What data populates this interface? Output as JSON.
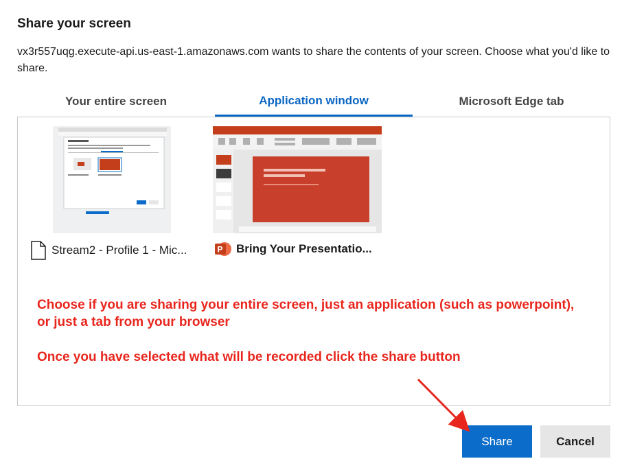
{
  "dialog": {
    "title": "Share your screen",
    "description": "vx3r557uqg.execute-api.us-east-1.amazonaws.com wants to share the contents of your screen. Choose what you'd like to share."
  },
  "tabs": [
    {
      "label": "Your entire screen",
      "active": false
    },
    {
      "label": "Application window",
      "active": true
    },
    {
      "label": "Microsoft Edge tab",
      "active": false
    }
  ],
  "windows": [
    {
      "label": "Stream2 - Profile 1 - Mic...",
      "icon": "document-icon"
    },
    {
      "label": "Bring Your Presentatio...",
      "icon": "powerpoint-icon"
    }
  ],
  "annotation": {
    "line1": "Choose if you are sharing your entire screen, just an application (such as powerpoint), or just a tab from your browser",
    "line2": "Once you have selected what will be recorded click the share button"
  },
  "buttons": {
    "share": "Share",
    "cancel": "Cancel"
  },
  "colors": {
    "accent": "#0b6cc9",
    "annotation": "#e8261d",
    "powerpoint": "#c43e1c"
  }
}
